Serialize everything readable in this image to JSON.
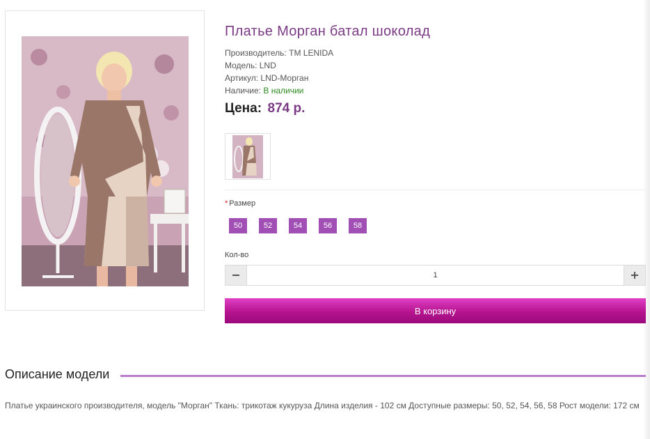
{
  "product": {
    "title": "Платье Морган батал шоколад",
    "manufacturer_label": "Производитель:",
    "manufacturer": "TM LENIDA",
    "model_label": "Модель:",
    "model": "LND",
    "sku_label": "Артикул:",
    "sku": "LND-Морган",
    "availability_label": "Наличие:",
    "availability": "В наличии",
    "price_label": "Цена:",
    "price": "874 р."
  },
  "options": {
    "size_label": "Размер",
    "required_mark": "*",
    "sizes": [
      "50",
      "52",
      "54",
      "56",
      "58"
    ]
  },
  "quantity": {
    "label": "Кол-во",
    "value": "1"
  },
  "cart": {
    "button_label": "В корзину"
  },
  "description": {
    "heading": "Описание модели",
    "text": "Платье украинского производителя, модель \"Морган\" Ткань: трикотаж кукуруза Длина изделия - 102 см Доступные размеры: 50, 52, 54, 56, 58 Рост модели: 172 см"
  },
  "icons": {
    "minus": "minus-icon",
    "plus": "plus-icon"
  },
  "colors": {
    "accent": "#a14fb5",
    "title": "#7a3a84",
    "in_stock": "#2d8a1f",
    "cart_button": "#c21a9f"
  }
}
